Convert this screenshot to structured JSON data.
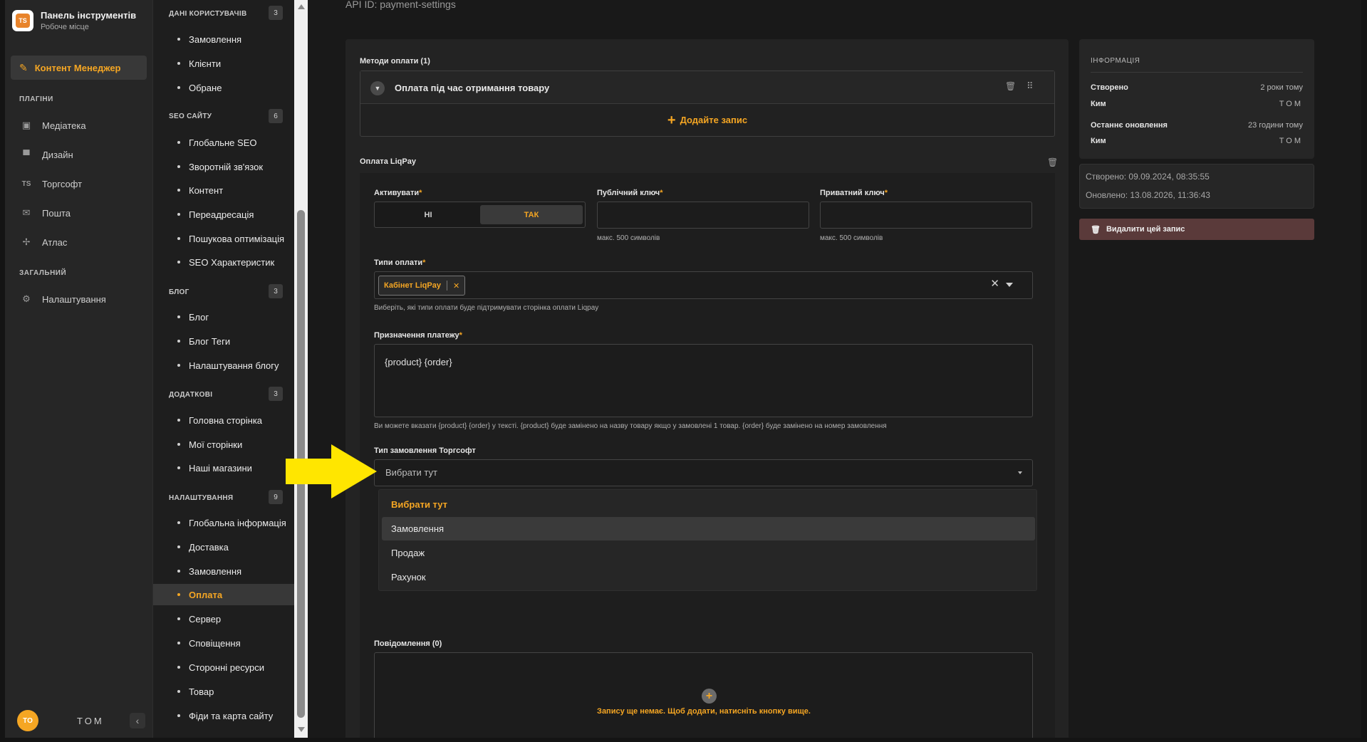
{
  "app": {
    "title": "Панель інструментів",
    "subtitle": "Робоче місце",
    "logo_text": "TS"
  },
  "sidebar": {
    "primary": {
      "label": "Контент Менеджер",
      "icon": "edit-icon"
    },
    "sections": [
      {
        "label": "ПЛАГІНИ",
        "items": [
          {
            "label": "Медіатека",
            "icon": "image-icon"
          },
          {
            "label": "Дизайн",
            "icon": "paint-roller-icon"
          },
          {
            "label": "Торгсофт",
            "icon": "ts-icon"
          },
          {
            "label": "Пошта",
            "icon": "mail-icon"
          },
          {
            "label": "Атлас",
            "icon": "atlas-icon"
          }
        ]
      },
      {
        "label": "ЗАГАЛЬНИЙ",
        "items": [
          {
            "label": "Налаштування",
            "icon": "gear-icon"
          }
        ]
      }
    ],
    "user": {
      "initials": "TO",
      "name": "TOM"
    },
    "collapse_icon": "chevron-left-icon"
  },
  "subnav": {
    "groups": [
      {
        "label": "ДАНІ КОРИСТУВАЧІВ",
        "count": "3",
        "items": [
          "Замовлення",
          "Клієнти",
          "Обране"
        ]
      },
      {
        "label": "SEO САЙТУ",
        "count": "6",
        "items": [
          "Глобальне SEO",
          "Зворотній зв'язок",
          "Контент",
          "Переадресація",
          "Пошукова оптимізація",
          "SEO Характеристик"
        ]
      },
      {
        "label": "БЛОГ",
        "count": "3",
        "items": [
          "Блог",
          "Блог Теги",
          "Налаштування блогу"
        ]
      },
      {
        "label": "ДОДАТКОВІ",
        "count": "3",
        "items": [
          "Головна сторінка",
          "Мої сторінки",
          "Наші магазини"
        ]
      },
      {
        "label": "НАЛАШТУВАННЯ",
        "count": "9",
        "items": [
          "Глобальна інформація",
          "Доставка",
          "Замовлення",
          "Оплата",
          "Сервер",
          "Сповіщення",
          "Сторонні ресурси",
          "Товар",
          "Фіди та карта сайту"
        ]
      }
    ],
    "active": "Оплата"
  },
  "main": {
    "api_id": "API ID: payment-settings",
    "payment_methods": {
      "label": "Методи оплати (1)",
      "item": "Оплата під час отримання товару",
      "add_label": "Додайте запис"
    },
    "liqpay": {
      "title": "Оплата LiqPay",
      "activate": {
        "label": "Активувати",
        "required_mark": "*",
        "no": "НІ",
        "yes": "ТАК",
        "selected": "ТАК"
      },
      "public_key": {
        "label": "Публічний ключ",
        "required_mark": "*",
        "value": "",
        "help": "макс. 500 символів"
      },
      "private_key": {
        "label": "Приватний ключ",
        "required_mark": "*",
        "value": "",
        "help": "макс. 500 символів"
      },
      "payment_types": {
        "label": "Типи оплати",
        "required_mark": "*",
        "chips": [
          "Кабінет LiqPay"
        ],
        "help": "Виберіть, які типи оплати буде підтримувати сторінка оплати Liqpay"
      },
      "purpose": {
        "label": "Призначення платежу",
        "required_mark": "*",
        "value": "{product} {order}",
        "help": "Ви можете вказати {product} {order} у тексті. {product} буде замінено на назву товару якщо у замовлені 1 товар. {order} буде замінено на номер замовлення"
      },
      "order_type": {
        "label": "Тип замовлення Торгсофт",
        "value": "Вибрати тут",
        "options": [
          "Вибрати тут",
          "Замовлення",
          "Продаж",
          "Рахунок"
        ],
        "highlighted": "Замовлення"
      },
      "messages": {
        "label": "Повідомлення (0)",
        "empty_text": "Запису ще немає. Щоб додати, натисніть кнопку вище."
      }
    }
  },
  "info": {
    "heading": "ІНФОРМАЦІЯ",
    "created_label": "Створено",
    "created_value": "2 роки тому",
    "who_label": "Ким",
    "who_value": "TOM",
    "updated_label": "Останнє оновлення",
    "updated_value": "23 години тому",
    "who2_label": "Ким",
    "who2_value": "TOM",
    "created_full": "Створено: 09.09.2024, 08:35:55",
    "updated_full": "Оновлено: 13.08.2026, 11:36:43",
    "delete_label": "Видалити цей запис"
  },
  "colors": {
    "accent": "#f5a623",
    "danger_bg": "#5a3a3a",
    "annotation_arrow": "#ffe600"
  }
}
